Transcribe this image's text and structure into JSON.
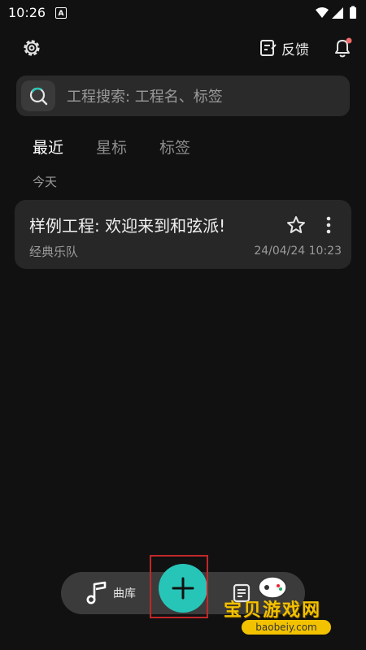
{
  "status_bar": {
    "time": "10:26",
    "notification_icon_letter": "A"
  },
  "header": {
    "feedback_label": "反馈"
  },
  "search": {
    "placeholder": "工程搜索: 工程名、标签"
  },
  "tabs": [
    {
      "label": "最近",
      "active": true
    },
    {
      "label": "星标",
      "active": false
    },
    {
      "label": "标签",
      "active": false
    }
  ],
  "section": {
    "label": "今天"
  },
  "projects": [
    {
      "title": "样例工程: 欢迎来到和弦派!",
      "subtitle": "经典乐队",
      "date": "24/04/24 10:23",
      "starred": false
    }
  ],
  "bottom_nav": {
    "library_label": "曲库"
  },
  "watermark": {
    "text": "宝贝游戏网",
    "domain": "baobeiy.com"
  },
  "colors": {
    "accent": "#27c5b8",
    "background": "#111111",
    "card": "#272727",
    "notification_dot": "#f26b6b"
  },
  "icons": [
    "settings-icon",
    "feedback-icon",
    "bell-icon",
    "search-icon",
    "star-icon",
    "more-vertical-icon",
    "music-note-icon",
    "plus-icon",
    "list-icon"
  ]
}
